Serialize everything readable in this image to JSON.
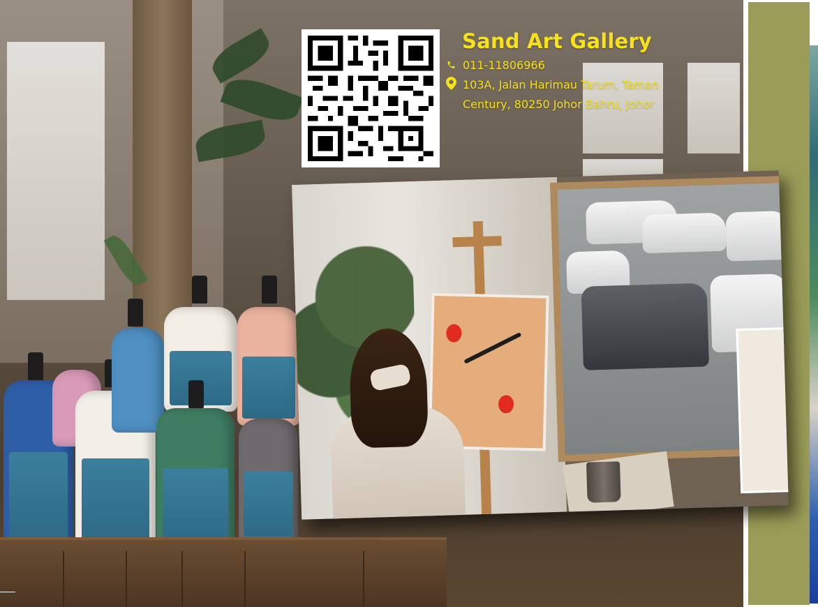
{
  "gallery": {
    "name": "Sand Art Gallery",
    "phone": "011-11806966",
    "address_line1": "103A, Jalan Harimau Tarum, Taman",
    "address_line2": "Century, 80250 Johor Bahru, Johor"
  },
  "icons": {
    "phone": "phone-icon",
    "location": "map-pin-icon",
    "qr": "qr-code"
  },
  "colors": {
    "accent_yellow": "#f7e21a",
    "olive_panel": "#9a9c58"
  }
}
